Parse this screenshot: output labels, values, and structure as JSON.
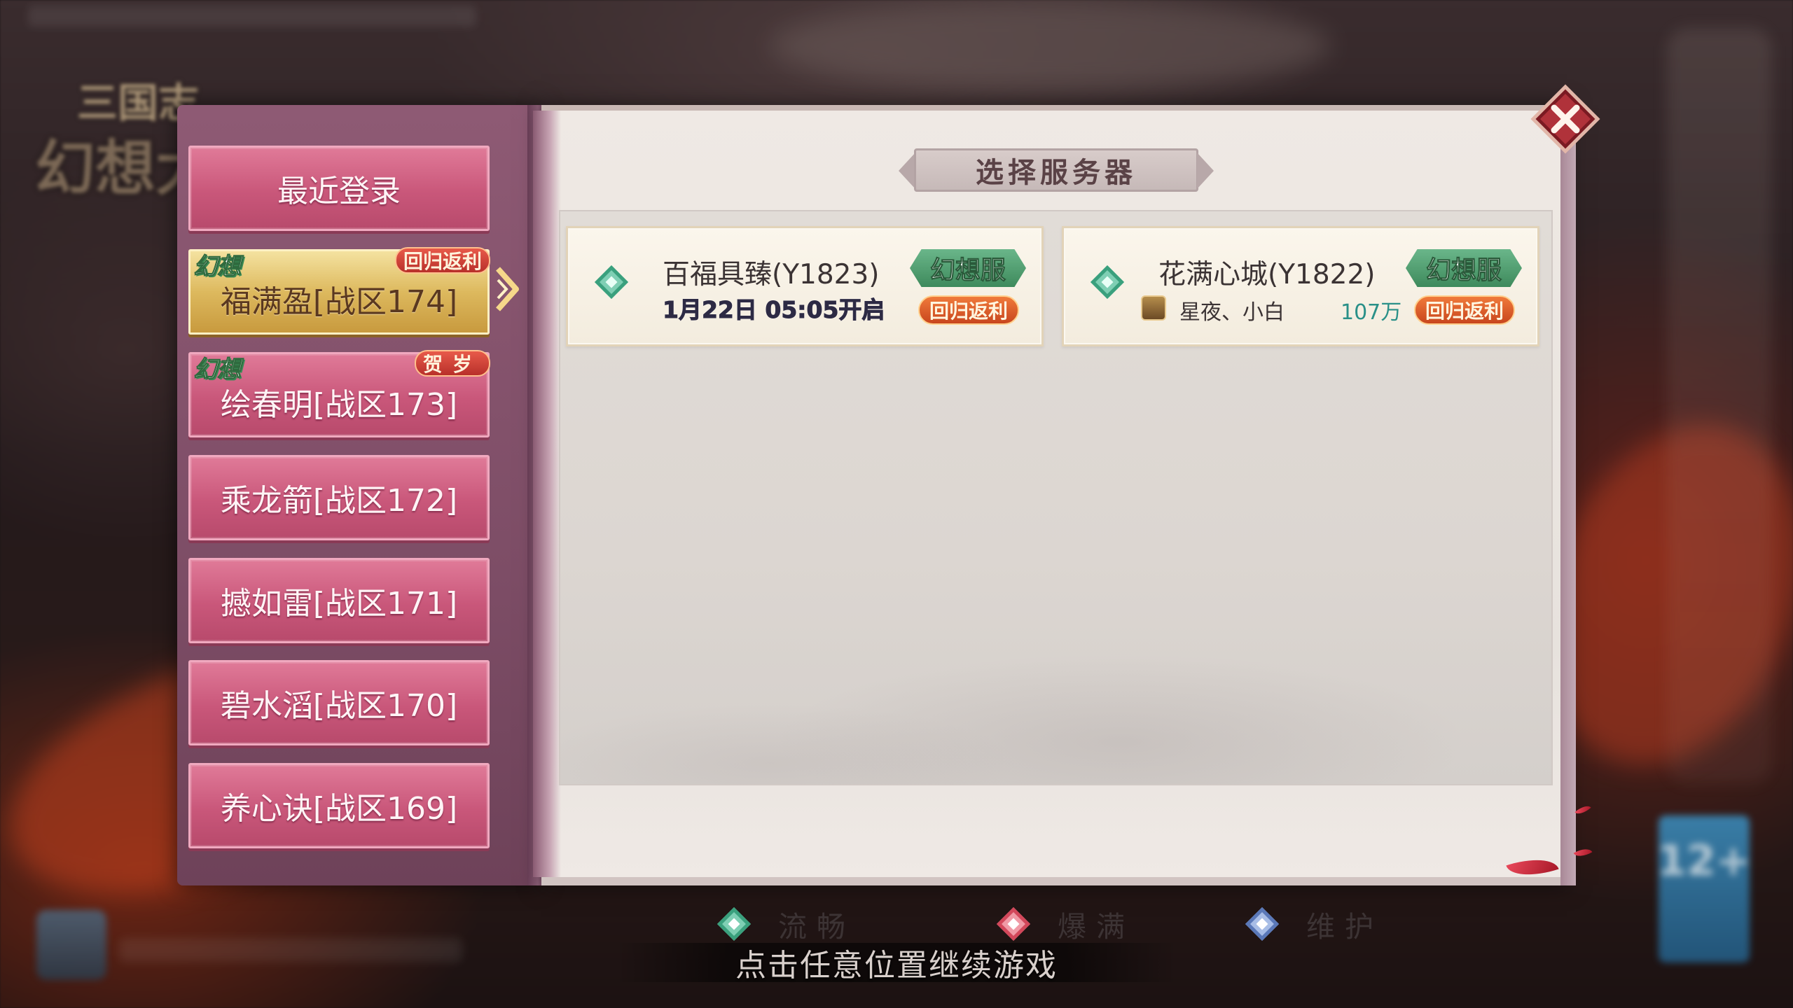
{
  "background": {
    "logo_line1": "三国志",
    "logo_line2": "幻想大",
    "age_rating": "12+"
  },
  "dialog": {
    "title": "选择服务器",
    "left_tabs": [
      {
        "label": "最近登录",
        "active": false
      },
      {
        "label": "福满盈[战区174]",
        "active": true,
        "badge_left": "幻想",
        "badge_right": "回归返利"
      },
      {
        "label": "绘春明[战区173]",
        "active": false,
        "badge_left": "幻想",
        "badge_right": "贺岁"
      },
      {
        "label": "乘龙箭[战区172]",
        "active": false
      },
      {
        "label": "撼如雷[战区171]",
        "active": false
      },
      {
        "label": "碧水滔[战区170]",
        "active": false
      },
      {
        "label": "养心诀[战区169]",
        "active": false
      }
    ],
    "servers": [
      {
        "name": "百福具臻(Y1823)",
        "open_time": "1月22日 05:05开启",
        "tag_type": "幻想服",
        "tag_event": "回归返利",
        "status": "流畅"
      },
      {
        "name": "花满心城(Y1822)",
        "role": "星夜、小白",
        "power": "107万",
        "tag_type": "幻想服",
        "tag_event": "回归返利",
        "status": "流畅"
      }
    ],
    "legend": [
      {
        "label": "流畅",
        "color": "#3aa07d",
        "fill": "#7fcfb4"
      },
      {
        "label": "爆满",
        "color": "#d2475a",
        "fill": "#f09aa6"
      },
      {
        "label": "维护",
        "color": "#5a78b8",
        "fill": "#a8bde6"
      }
    ]
  },
  "footer": {
    "continue_text": "点击任意位置继续游戏"
  }
}
